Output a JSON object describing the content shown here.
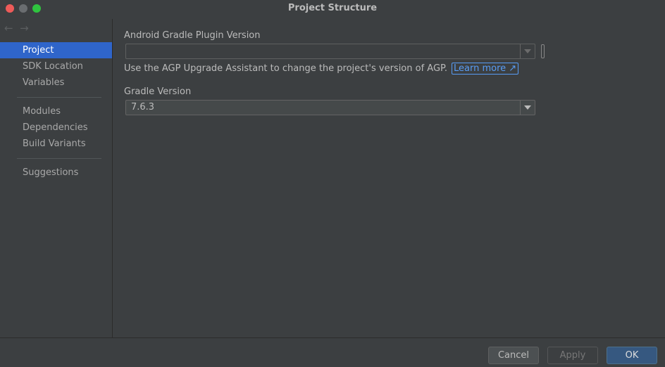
{
  "window": {
    "title": "Project Structure"
  },
  "nav": {
    "back_icon": "←",
    "forward_icon": "→",
    "items": [
      {
        "label": "Project"
      },
      {
        "label": "SDK Location"
      },
      {
        "label": "Variables"
      },
      {
        "label": "Modules"
      },
      {
        "label": "Dependencies"
      },
      {
        "label": "Build Variants"
      },
      {
        "label": "Suggestions"
      }
    ]
  },
  "main": {
    "agp_label": "Android Gradle Plugin Version",
    "agp_value": "",
    "hint_text": "Use the AGP Upgrade Assistant to change the project's version of AGP.",
    "learn_more": "Learn more ↗",
    "gradle_label": "Gradle Version",
    "gradle_value": "7.6.3"
  },
  "footer": {
    "cancel": "Cancel",
    "apply": "Apply",
    "ok": "OK"
  },
  "colors": {
    "background": "#3c3f41",
    "selection": "#2f65ca",
    "link": "#589df6",
    "ok_button": "#365880"
  }
}
